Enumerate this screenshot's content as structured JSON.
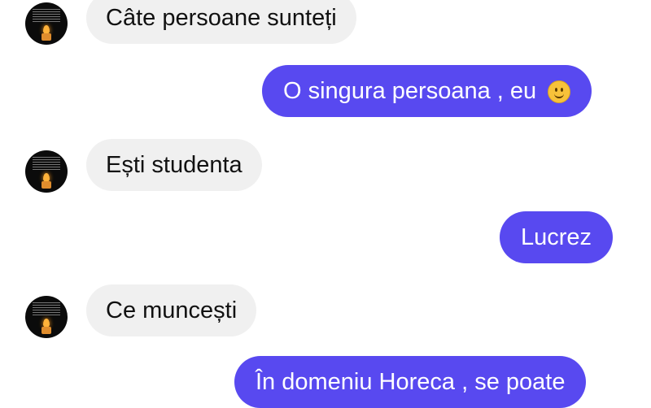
{
  "chat": {
    "messages": [
      {
        "direction": "incoming",
        "text": "Câte persoane sunteți"
      },
      {
        "direction": "outgoing",
        "text": "O singura persoana , eu",
        "emoji": "slightly-smiling-face-emoji"
      },
      {
        "direction": "incoming",
        "text": "Ești studenta"
      },
      {
        "direction": "outgoing",
        "text": "Lucrez"
      },
      {
        "direction": "incoming",
        "text": "Ce muncești"
      },
      {
        "direction": "outgoing",
        "text": "În domeniu Horeca , se poate"
      }
    ]
  },
  "colors": {
    "outgoing_bubble": "#5849f0",
    "incoming_bubble": "#f0f0f0",
    "background": "#ffffff"
  }
}
